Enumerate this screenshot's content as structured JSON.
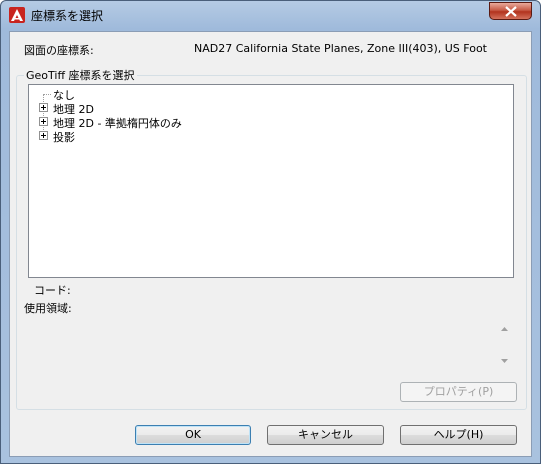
{
  "window": {
    "title": "座標系を選択"
  },
  "drawing_cs": {
    "label": "図面の座標系:",
    "value": "NAD27 California State Planes, Zone III(403), US Foot"
  },
  "geotiff": {
    "group_title": "GeoTiff 座標系を選択",
    "tree_items": [
      {
        "label": "なし",
        "expandable": false
      },
      {
        "label": "地理 2D",
        "expandable": true
      },
      {
        "label": "地理 2D - 準拠楕円体のみ",
        "expandable": true
      },
      {
        "label": "投影",
        "expandable": true
      }
    ]
  },
  "details": {
    "code_label": "コード:",
    "area_label": "使用領域:"
  },
  "buttons": {
    "properties": "プロパティ(P)",
    "ok": "OK",
    "cancel": "キャンセル",
    "help": "ヘルプ(H)"
  },
  "icons": {
    "app": "autocad-icon",
    "close": "close-icon",
    "scroll_up": "scroll-up-arrow-icon",
    "scroll_down": "scroll-down-arrow-icon"
  },
  "colors": {
    "title_bar": "#a9c2df",
    "close_button": "#c75a46",
    "dialog_bg": "#f0f0f0",
    "app_icon": "#c8241f"
  }
}
